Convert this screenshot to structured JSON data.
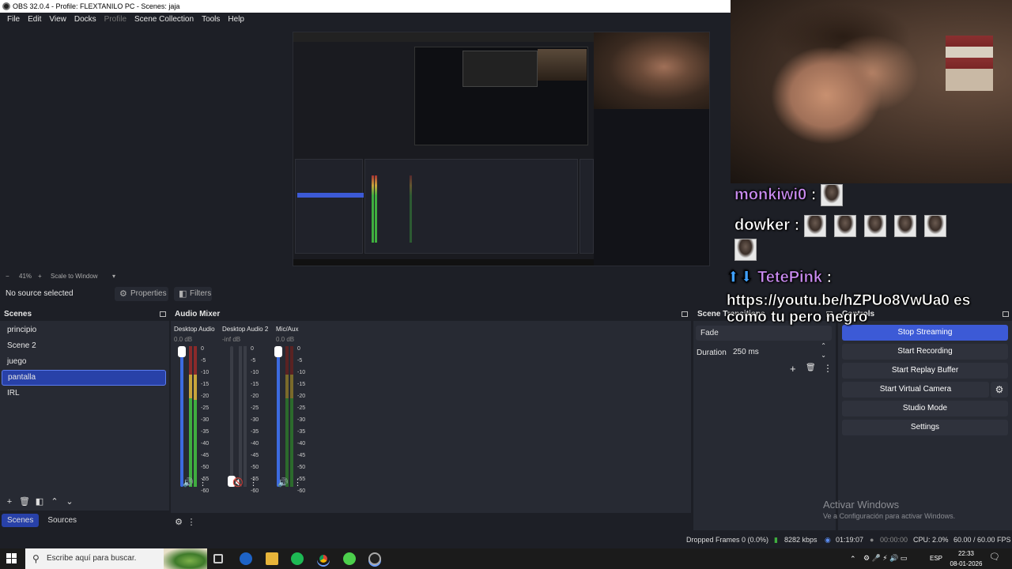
{
  "window": {
    "title": "OBS 32.0.4 - Profile: FLEXTANILO PC - Scenes: jaja"
  },
  "menu": [
    {
      "label": "File",
      "dim": false
    },
    {
      "label": "Edit",
      "dim": false
    },
    {
      "label": "View",
      "dim": false
    },
    {
      "label": "Docks",
      "dim": false
    },
    {
      "label": "Profile",
      "dim": true
    },
    {
      "label": "Scene Collection",
      "dim": false
    },
    {
      "label": "Tools",
      "dim": false
    },
    {
      "label": "Help",
      "dim": false
    }
  ],
  "preview": {
    "zoom": "41%",
    "scale_mode": "Scale to Window",
    "minus": "−",
    "plus": "+"
  },
  "sourcebar": {
    "no_source": "No source selected",
    "properties": "Properties",
    "filters": "Filters"
  },
  "scenes": {
    "title": "Scenes",
    "items": [
      "principio",
      "Scene 2",
      "juego",
      "pantalla",
      "IRL"
    ],
    "active_index": 3
  },
  "tabs": {
    "scenes": "Scenes",
    "sources": "Sources"
  },
  "mixer": {
    "title": "Audio Mixer",
    "channels": [
      {
        "name": "Desktop Audio",
        "db": "0.0 dB",
        "level": 1.0,
        "muted": false
      },
      {
        "name": "Desktop Audio 2",
        "db": "-inf dB",
        "level": 0.0,
        "muted": true
      },
      {
        "name": "Mic/Aux",
        "db": "0.0 dB",
        "level": 1.0,
        "muted": false
      }
    ],
    "ticks": [
      "0",
      "-5",
      "-10",
      "-15",
      "-20",
      "-25",
      "-30",
      "-35",
      "-40",
      "-45",
      "-50",
      "-55",
      "-60"
    ]
  },
  "transitions": {
    "title": "Scene Transitions",
    "type": "Fade",
    "duration_label": "Duration",
    "duration": "250 ms"
  },
  "controls": {
    "title": "Controls",
    "stop_streaming": "Stop Streaming",
    "start_recording": "Start Recording",
    "start_replay": "Start Replay Buffer",
    "start_vcam": "Start Virtual Camera",
    "studio_mode": "Studio Mode",
    "settings": "Settings"
  },
  "overlay": {
    "user1": "monkiwi0",
    "user2": "dowker",
    "user3": "TetePink",
    "colon": ":",
    "msg3_line1": "https://youtu.be/hZPUo8VwUa0 es",
    "msg3_line2": "como tu pero negro",
    "badge": "⬆⬇"
  },
  "statusbar": {
    "dropped": "Dropped Frames 0 (0.0%)",
    "bitrate": "8282 kbps",
    "live_time": "01:19:07",
    "rec_time": "00:00:00",
    "cpu": "CPU: 2.0%",
    "fps": "60.00 / 60.00 FPS"
  },
  "watermark": {
    "line1": "Activar Windows",
    "line2": "Ve a Configuración para activar Windows."
  },
  "taskbar": {
    "search_placeholder": "Escribe aquí para buscar.",
    "lang": "ESP",
    "time": "22:33",
    "date": "08-01-2026"
  },
  "colors": {
    "accent": "#3c5ad6",
    "bg": "#1d1f26",
    "panel": "#272a33",
    "green": "#1db954"
  }
}
